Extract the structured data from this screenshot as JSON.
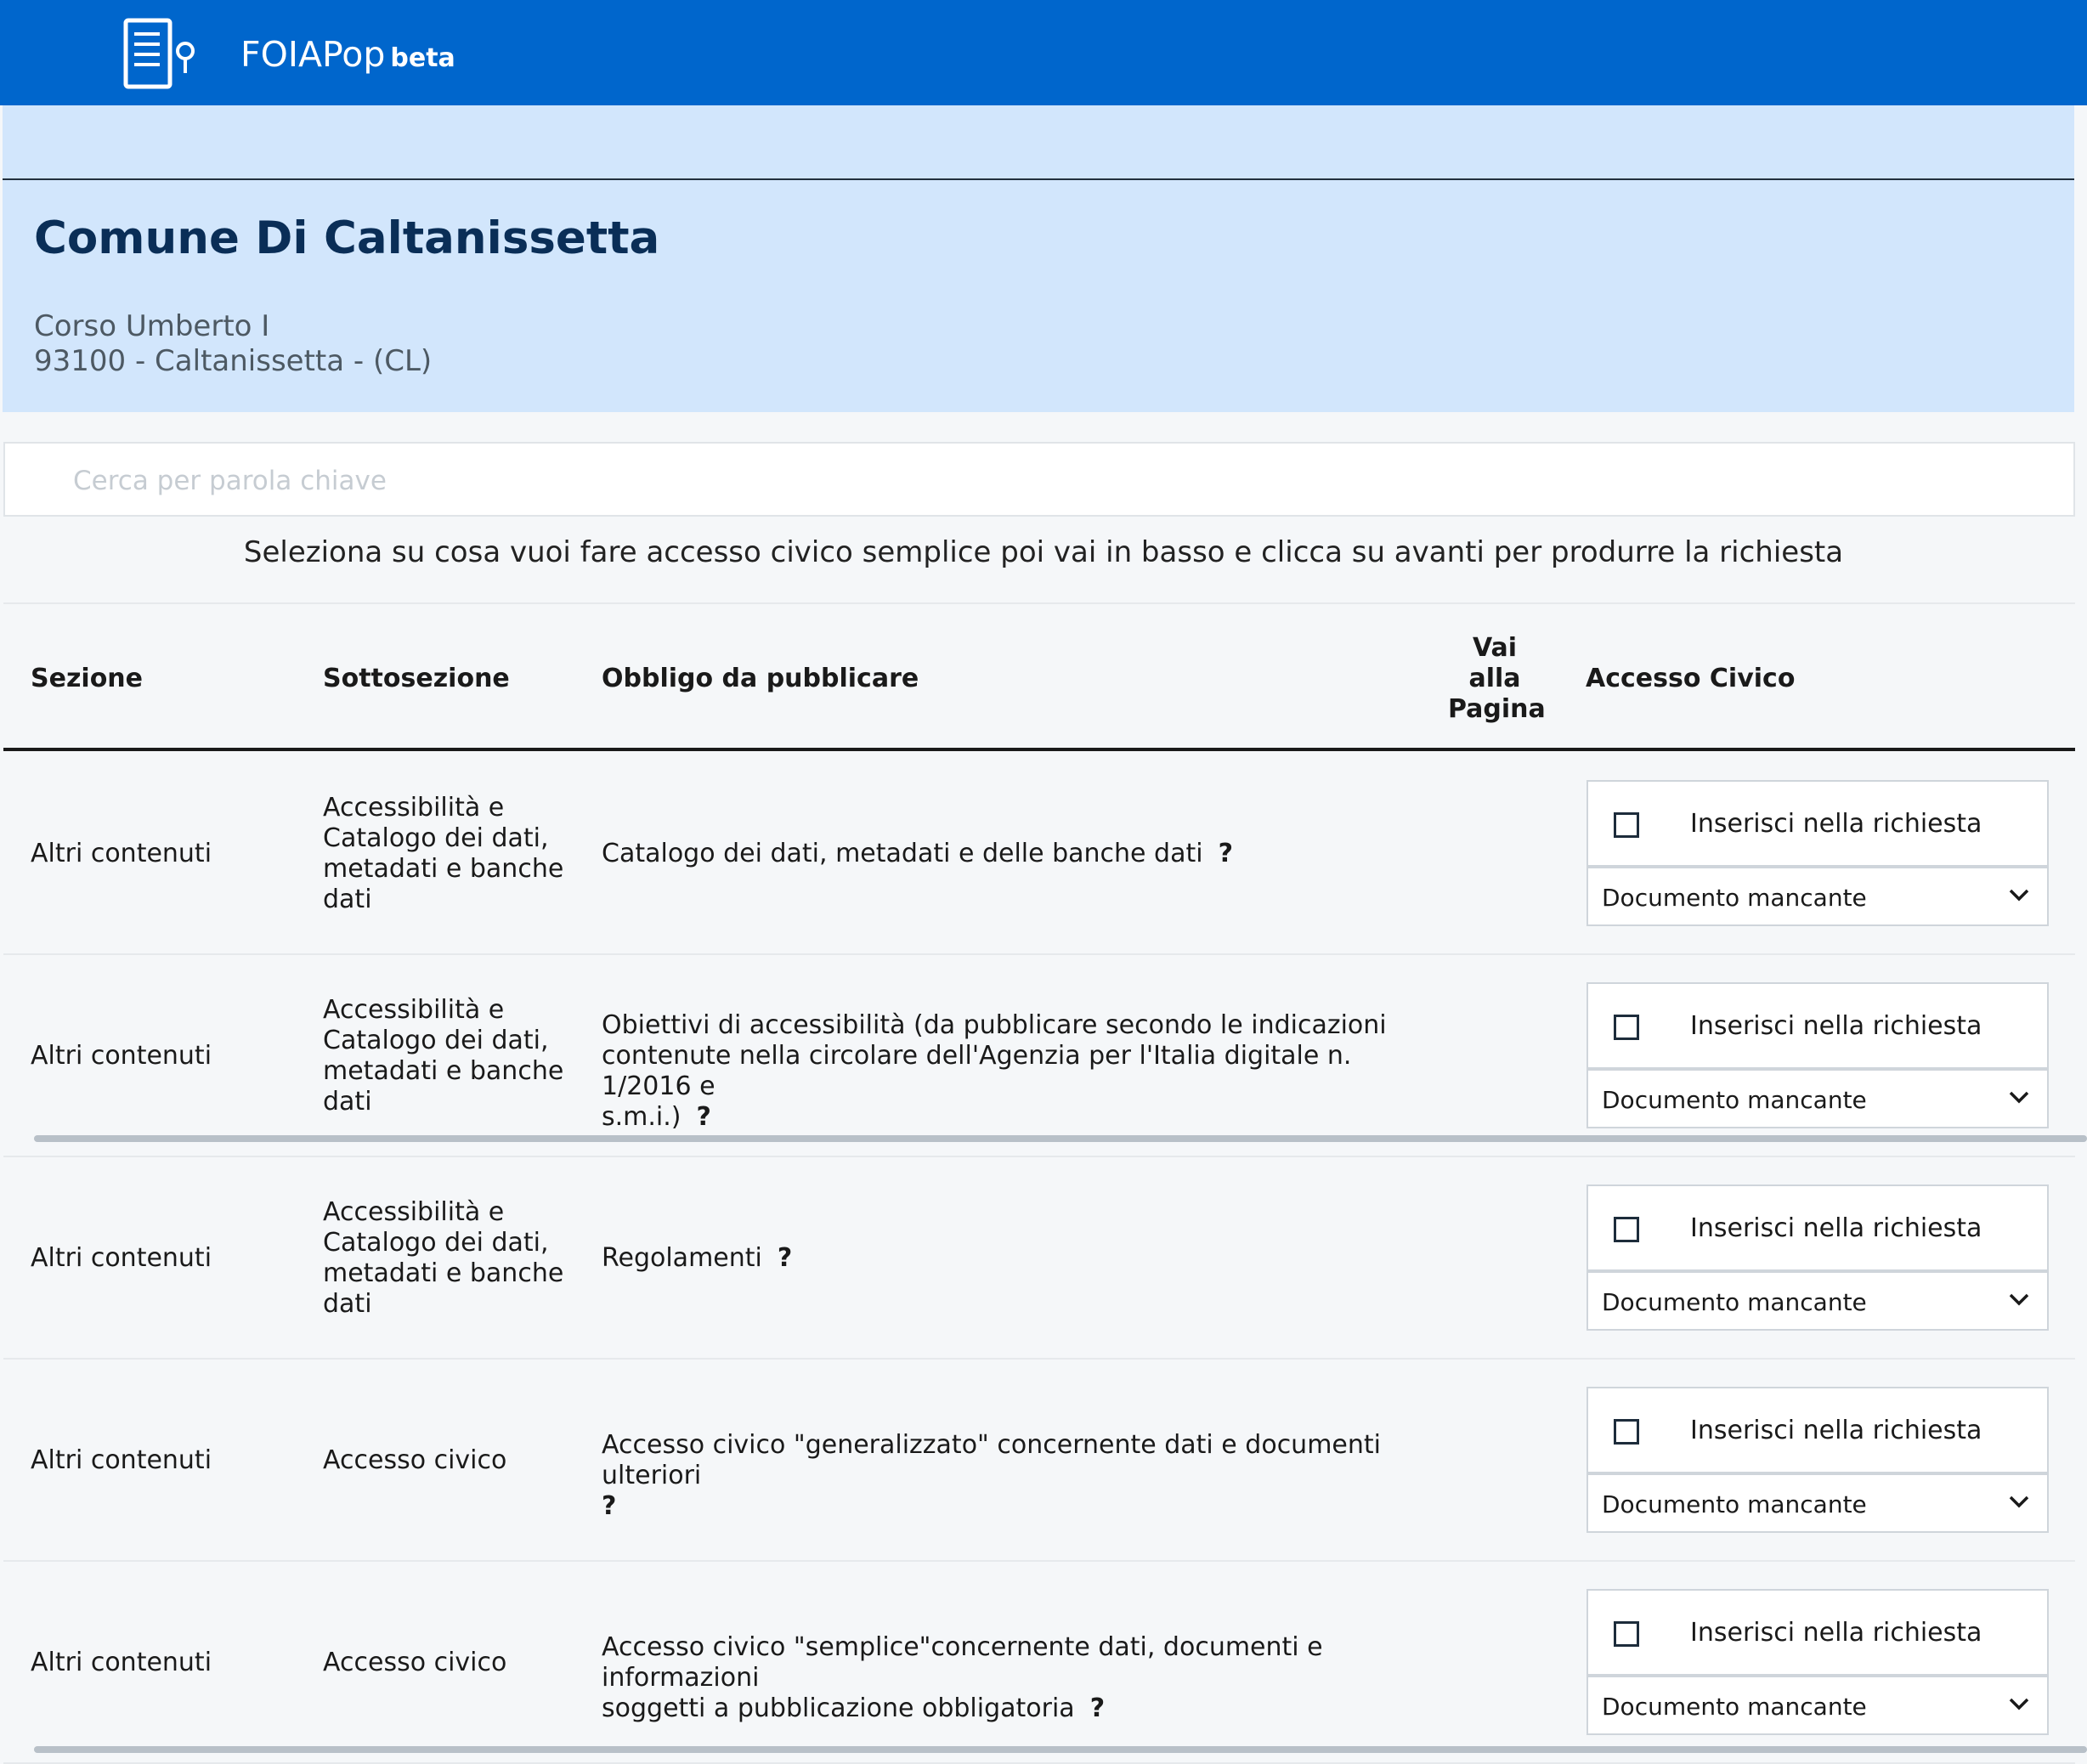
{
  "app": {
    "name": "FOIAPop",
    "badge": "beta"
  },
  "header": {
    "title": "Comune Di Caltanissetta",
    "address_line1": "Corso Umberto I",
    "address_line2": "93100 - Caltanissetta - (CL)"
  },
  "search": {
    "placeholder": "Cerca per parola chiave"
  },
  "instructions": "Seleziona su cosa vuoi fare accesso civico semplice poi vai in basso e clicca su avanti per produrre la richiesta",
  "table": {
    "headers": {
      "sezione": "Sezione",
      "sottosezione": "Sottosezione",
      "obbligo": "Obbligo da pubblicare",
      "vai_line1": "Vai",
      "vai_line2": "alla",
      "vai_line3": "Pagina",
      "accesso": "Accesso Civico"
    },
    "rows": [
      {
        "sezione": "Altri contenuti",
        "sottosezione_lines": [
          "Accessibilità e",
          "Catalogo dei dati,",
          "metadati e banche",
          "dati"
        ],
        "obbligo_lines": [
          "Catalogo dei dati, metadati e delle banche dati"
        ],
        "help": "?",
        "checkbox_label": "Inserisci nella richiesta",
        "select_value": "Documento mancante",
        "checked": false
      },
      {
        "sezione": "Altri contenuti",
        "sottosezione_lines": [
          "Accessibilità e",
          "Catalogo dei dati,",
          "metadati e banche",
          "dati"
        ],
        "obbligo_lines": [
          "Obiettivi di accessibilità (da pubblicare secondo le indicazioni",
          "contenute nella circolare dell'Agenzia per l'Italia digitale n. 1/2016 e",
          "s.m.i.)"
        ],
        "help": "?",
        "checkbox_label": "Inserisci nella richiesta",
        "select_value": "Documento mancante",
        "checked": false
      },
      {
        "sezione": "Altri contenuti",
        "sottosezione_lines": [
          "Accessibilità e",
          "Catalogo dei dati,",
          "metadati e banche",
          "dati"
        ],
        "obbligo_lines": [
          "Regolamenti"
        ],
        "help": "?",
        "checkbox_label": "Inserisci nella richiesta",
        "select_value": "Documento mancante",
        "checked": false
      },
      {
        "sezione": "Altri contenuti",
        "sottosezione_lines": [
          "Accesso civico"
        ],
        "obbligo_lines": [
          "Accesso civico \"generalizzato\" concernente dati e documenti ulteriori",
          ""
        ],
        "help": "?",
        "checkbox_label": "Inserisci nella richiesta",
        "select_value": "Documento mancante",
        "checked": false
      },
      {
        "sezione": "Altri contenuti",
        "sottosezione_lines": [
          "Accesso civico"
        ],
        "obbligo_lines": [
          "Accesso civico \"semplice\"concernente dati, documenti e informazioni",
          "soggetti a pubblicazione obbligatoria"
        ],
        "help": "?",
        "checkbox_label": "Inserisci nella richiesta",
        "select_value": "Documento mancante",
        "checked": false
      }
    ]
  },
  "colors": {
    "topbar": "#0066cc",
    "header_bg": "#d2e6fc",
    "title": "#0a2e57"
  }
}
